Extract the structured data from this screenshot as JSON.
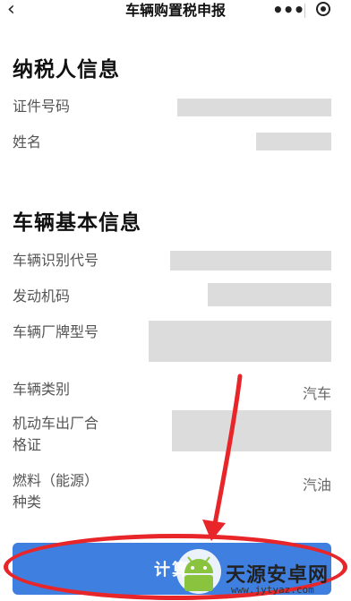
{
  "header": {
    "title": "车辆购置税申报",
    "back_icon": "chevron-left-icon",
    "more_icon": "more-dots-icon",
    "close_icon": "target-icon"
  },
  "taxpayer": {
    "title": "纳税人信息",
    "fields": [
      {
        "label": "证件号码"
      },
      {
        "label": "姓名"
      }
    ]
  },
  "vehicle": {
    "title": "车辆基本信息",
    "fields": [
      {
        "label": "车辆识别代号"
      },
      {
        "label": "发动机码"
      },
      {
        "label": "车辆厂牌型号"
      },
      {
        "label": "车辆类别",
        "value": "汽车"
      },
      {
        "label": "机动车出厂合",
        "label2": "格证"
      },
      {
        "label": "燃料（能源）",
        "label2": "种类",
        "value": "汽油"
      }
    ]
  },
  "action": {
    "calc_label": "计算"
  },
  "watermark": {
    "name": "天源安卓网",
    "url": "www.jytyaz.com"
  },
  "colors": {
    "button": "#3f7fe0",
    "annotation": "#e8262a",
    "redacted": "#dcdcdc"
  }
}
